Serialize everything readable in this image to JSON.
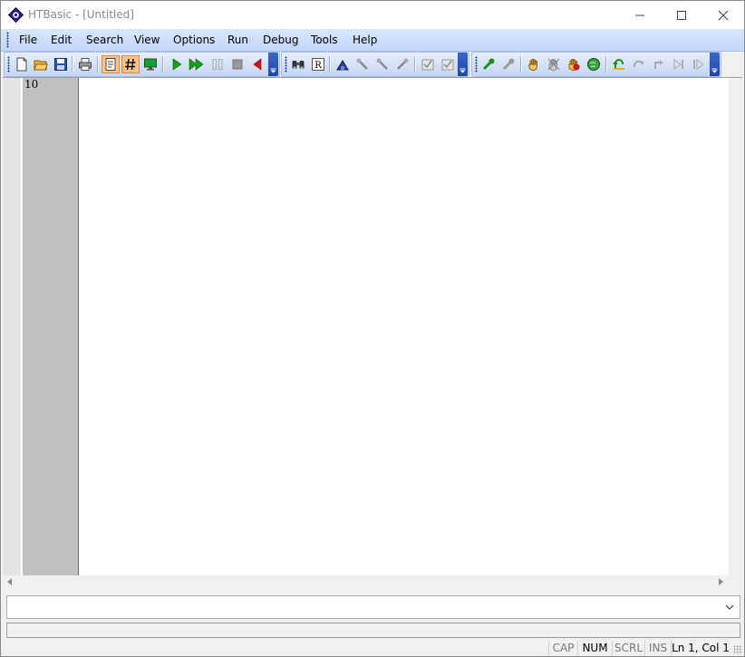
{
  "window": {
    "title": "HTBasic - [Untitled]"
  },
  "menu": [
    "File",
    "Edit",
    "Search",
    "View",
    "Options",
    "Run",
    "Debug",
    "Tools",
    "Help"
  ],
  "toolbar": {
    "icons": [
      "new-file",
      "open-folder",
      "save-disk",
      "print",
      "edit-mode",
      "line-numbers",
      "display",
      "run",
      "continue",
      "pause",
      "stop",
      "step-back",
      "find-binoculars",
      "replace",
      "tool-blue",
      "tool-gray-1",
      "tool-gray-2",
      "tool-gray-3",
      "check-gray-1",
      "check-gray-2",
      "wrench-green",
      "wrench-gray",
      "hand-yellow",
      "hand-crossed",
      "hand-red",
      "globe-hand",
      "undo-arrow",
      "redo-arrow",
      "step-gray",
      "skip-gray",
      "step-next-gray"
    ]
  },
  "editor": {
    "line_numbers": [
      "10"
    ],
    "content": ""
  },
  "command_line": {
    "value": ""
  },
  "message_line": {
    "text": ""
  },
  "status": {
    "cap": "CAP",
    "num": "NUM",
    "scrl": "SCRL",
    "ins": "INS",
    "position": "Ln 1, Col 1"
  },
  "colors": {
    "menubar": "#c9dbf7",
    "gutter": "#c0c0c0",
    "checked_button": "#ffc38a",
    "run_green": "#17a117",
    "toolbar_chevron": "#2a55b5"
  }
}
